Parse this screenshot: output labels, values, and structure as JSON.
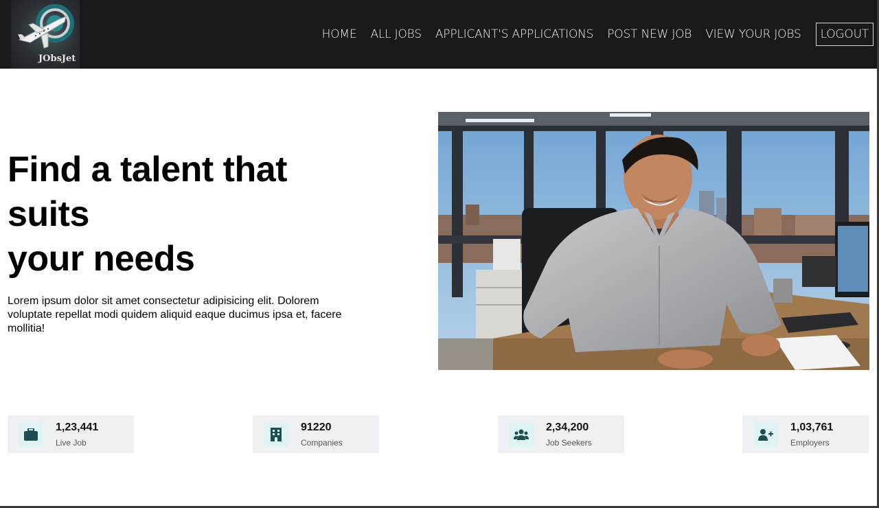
{
  "brand": {
    "logo_text": "JObsJet"
  },
  "nav": {
    "items": [
      {
        "label": "HOME"
      },
      {
        "label": "ALL JOBS"
      },
      {
        "label": "APPLICANT'S APPLICATIONS"
      },
      {
        "label": "POST NEW JOB"
      },
      {
        "label": "VIEW YOUR JOBS"
      }
    ],
    "logout_label": "LOGOUT"
  },
  "hero": {
    "title_line1": "Find a talent that",
    "title_line2": "suits",
    "title_line3": "your needs",
    "description": "Lorem ipsum dolor sit amet consectetur adipisicing elit. Dolorem voluptate repellat modi quidem aliquid eaque ducimus ipsa et, facere mollitia!"
  },
  "stats": [
    {
      "icon": "briefcase-icon",
      "value": "1,23,441",
      "label": "Live Job"
    },
    {
      "icon": "building-icon",
      "value": "91220",
      "label": "Companies"
    },
    {
      "icon": "users-icon",
      "value": "2,34,200",
      "label": "Job Seekers"
    },
    {
      "icon": "user-plus-icon",
      "value": "1,03,761",
      "label": "Employers"
    }
  ],
  "colors": {
    "navbar_bg": "#18191c",
    "stat_bg": "#eef0f3",
    "icon_bg": "#dff3f4",
    "icon_color": "#1d4e52"
  }
}
